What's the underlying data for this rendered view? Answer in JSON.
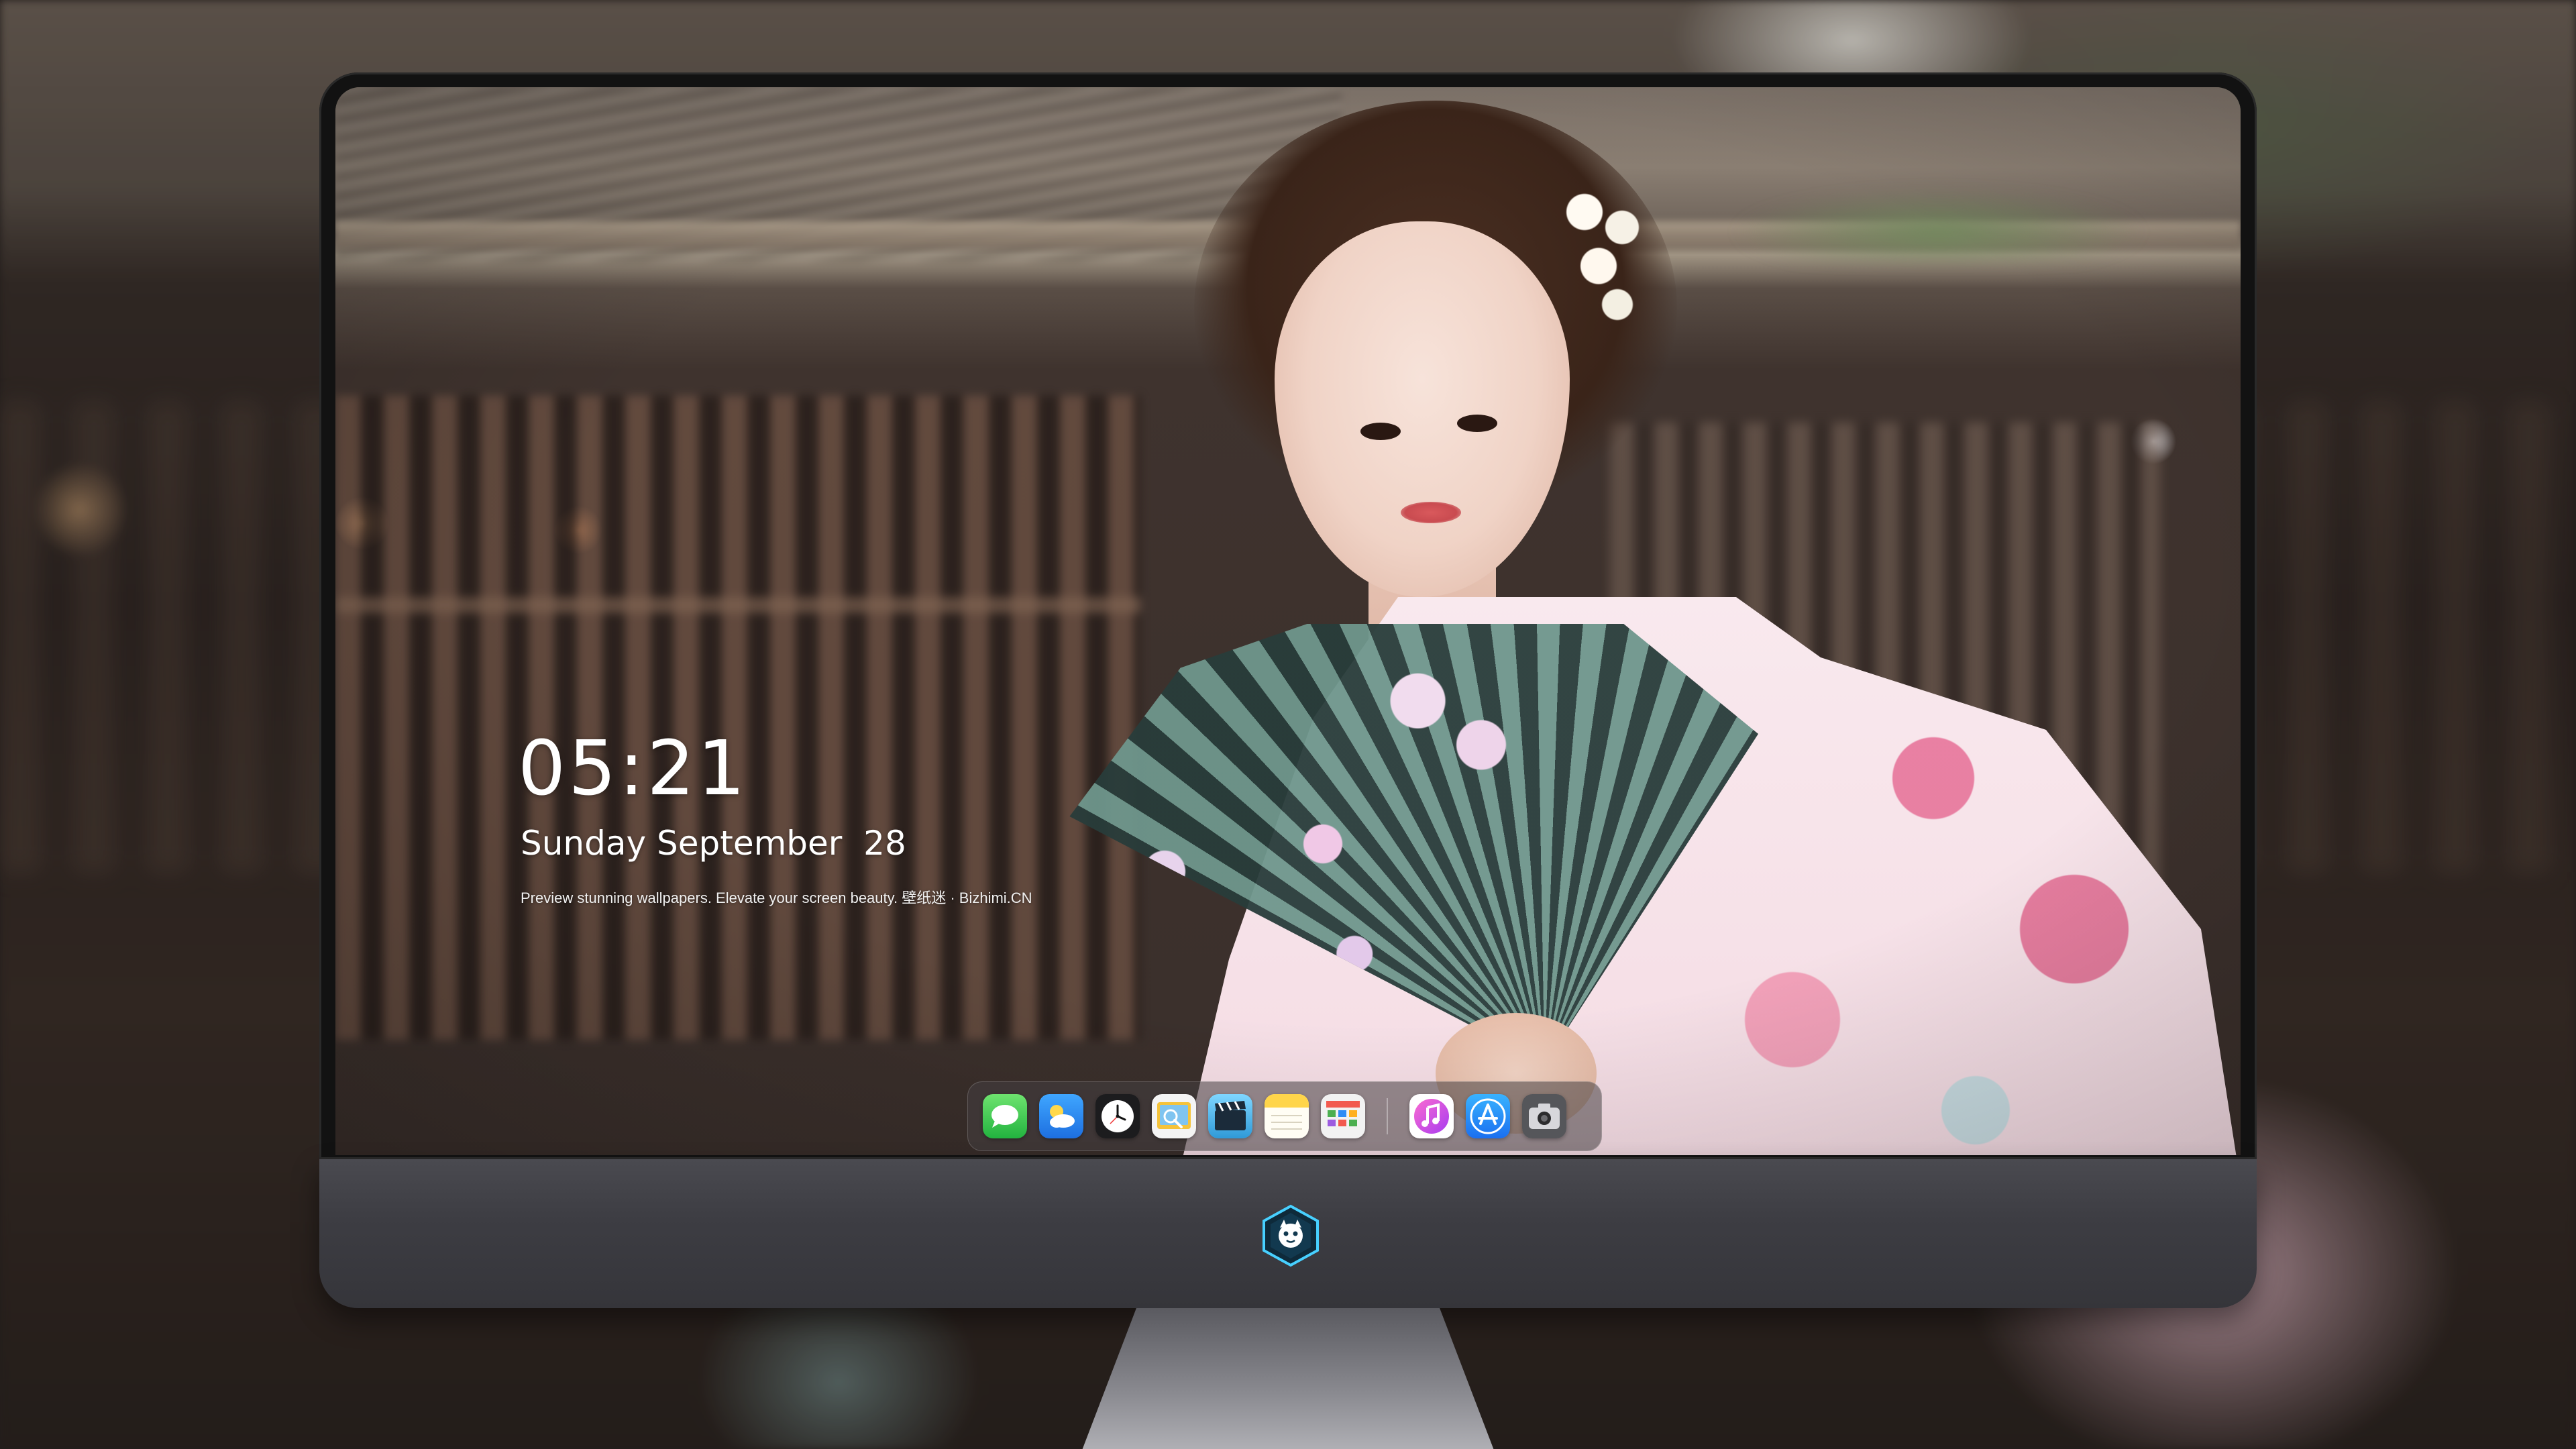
{
  "lockscreen": {
    "time": "05:21",
    "date": "Sunday September  28",
    "tagline": "Preview stunning wallpapers. Elevate your screen beauty. 壁纸迷 · Bizhimi.CN"
  },
  "dock": {
    "apps": [
      {
        "icon": "messages-icon",
        "color": "#35c759"
      },
      {
        "icon": "weather-icon",
        "color": "#2f8cf5"
      },
      {
        "icon": "clock-icon",
        "color": "#1c1c1e"
      },
      {
        "icon": "preview-icon",
        "color": "#f5c33b"
      },
      {
        "icon": "clips-icon",
        "color": "#4fb7ea"
      },
      {
        "icon": "notes-icon",
        "color": "#ffd54a"
      },
      {
        "icon": "calendar-icon",
        "color": "#f2f2f2"
      },
      {
        "icon": "music-icon",
        "color": "#e94bd8"
      },
      {
        "icon": "app-store-icon",
        "color": "#1e8ff5"
      },
      {
        "icon": "camera-icon",
        "color": "#8e8e93"
      }
    ]
  },
  "colors": {
    "bezel": "#121212",
    "chin": "#3d3d43",
    "text": "#ffffff"
  },
  "chin_logo": {
    "icon": "brand-logo-icon"
  }
}
